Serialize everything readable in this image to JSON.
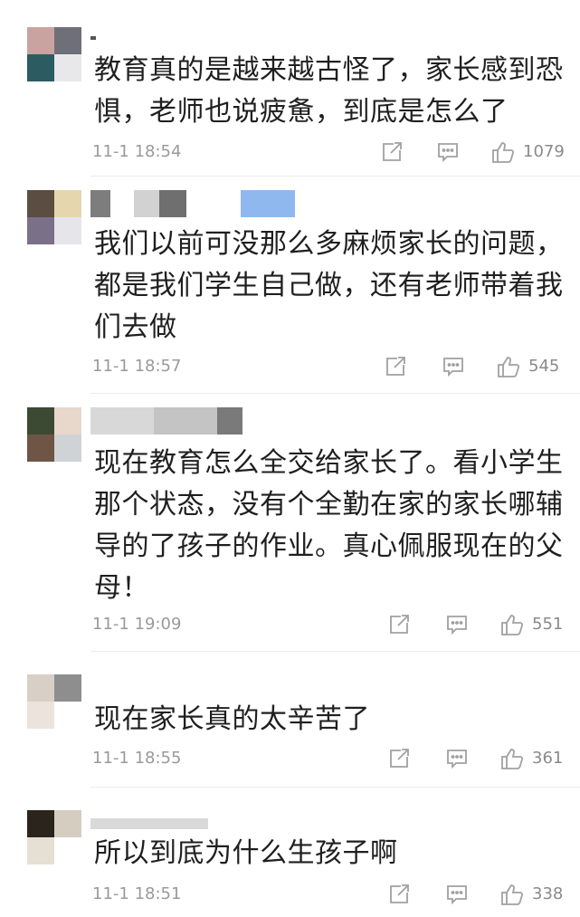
{
  "comments": [
    {
      "text": "教育真的是越来越古怪了，家长感到恐惧，老师也说疲惫，到底是怎么了",
      "time": "11-1 18:54",
      "likes": "1079",
      "avatar_colors": [
        "#c9a3a0",
        "#6e6f78",
        "#2d5b62",
        "#e8e8ea"
      ]
    },
    {
      "text": "我们以前可没那么多麻烦家长的问题，都是我们学生自己做，还有老师带着我们去做",
      "time": "11-1 18:57",
      "likes": "545",
      "avatar_colors": [
        "#5b4d41",
        "#e6d6ad",
        "#7a7088",
        "#e6e6ea"
      ]
    },
    {
      "text": "现在教育怎么全交给家长了。看小学生那个状态，没有个全勤在家的家长哪辅导的了孩子的作业。真心佩服现在的父母！",
      "time": "11-1 19:09",
      "likes": "551",
      "avatar_colors": [
        "#3d4a33",
        "#e8d7cb",
        "#6e5546",
        "#cfd3d6"
      ]
    },
    {
      "text": "现在家长真的太辛苦了",
      "time": "11-1 18:55",
      "likes": "361",
      "avatar_colors": [
        "#d8d0c6",
        "#8e8e8e",
        "#ece4dc",
        "#ffffff"
      ]
    },
    {
      "text": "所以到底为什么生孩子啊",
      "time": "11-1 18:51",
      "likes": "338",
      "avatar_colors": [
        "#2a241d",
        "#d5cdbf",
        "#e6dfd3",
        "#ffffff"
      ]
    }
  ],
  "icons": {
    "share": "share-icon",
    "comment": "comment-icon",
    "like": "thumbs-up-icon"
  },
  "colors": {
    "text": "#1f1f1f",
    "meta": "#9a9a9a",
    "icon": "#a0a0a0",
    "divider": "#ececec"
  }
}
